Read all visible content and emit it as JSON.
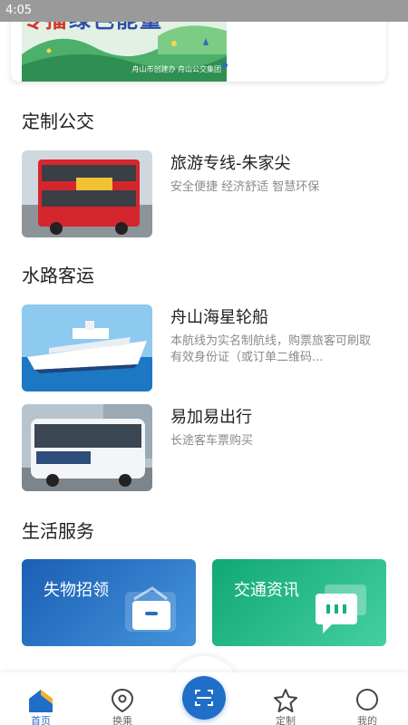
{
  "status_bar": {
    "time": "4:05"
  },
  "banner": {
    "headline_red": "专播",
    "headline_blue": "绿色能量",
    "caption": "舟山市创建办  舟山公交集团"
  },
  "sections": {
    "custom_bus": "定制公交",
    "water_transport": "水路客运",
    "life_services": "生活服务"
  },
  "items": {
    "tour_line": {
      "title": "旅游专线-朱家尖",
      "desc": "安全便捷 经济舒适 智慧环保"
    },
    "ship": {
      "title": "舟山海星轮船",
      "desc": "本航线为实名制航线，购票旅客可刷取有效身份证（或订单二维码..."
    },
    "yijiayi": {
      "title": "易加易出行",
      "desc": "长途客车票购买"
    }
  },
  "services": {
    "lost_found": "失物招领",
    "traffic_info": "交通资讯"
  },
  "colors": {
    "primary": "#1f6ec8",
    "lost_found_gradient": [
      "#1a5fb4",
      "#3f8fd8"
    ],
    "traffic_gradient": [
      "#13b07c",
      "#3ec99a"
    ]
  },
  "tabs": [
    {
      "label": "首页",
      "icon": "home-icon",
      "active": true
    },
    {
      "label": "换乘",
      "icon": "location-pin-icon",
      "active": false
    },
    {
      "label": "",
      "icon": "scan-icon",
      "active": false
    },
    {
      "label": "定制",
      "icon": "star-icon",
      "active": false
    },
    {
      "label": "我的",
      "icon": "profile-icon",
      "active": false
    }
  ]
}
